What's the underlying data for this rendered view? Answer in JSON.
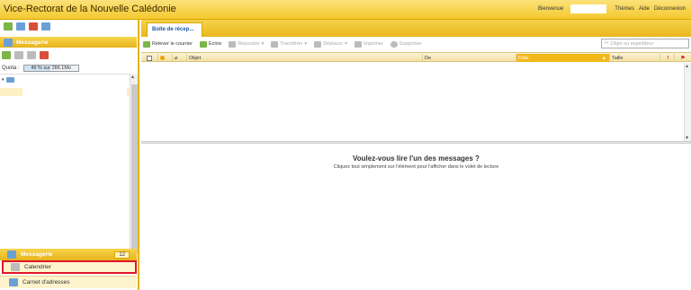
{
  "header": {
    "title": "Vice-Rectorat de la Nouvelle Calédonie",
    "welcome": "Bienvenue",
    "links": [
      "Thèmes",
      "Aide",
      "Déconnexion"
    ]
  },
  "left": {
    "section_title": "Messagerie",
    "quota_label": "Quota :",
    "quota_value": "49 % sur 286.1Mo",
    "quota_percent": 49,
    "nav": {
      "messagerie_label": "Messagerie",
      "messagerie_count": "12",
      "calendrier_label": "Calendrier",
      "carnet_label": "Carnet d'adresses"
    }
  },
  "main": {
    "tab_label": "Boîte de récep...",
    "toolbar": {
      "relever": "Relever le courrier",
      "ecrire": "Ecrire",
      "repondre": "Répondre",
      "transferer": "Transférer",
      "deplacer": "Déplacer",
      "imprimer": "Imprimer",
      "supprimer": "Supprimer"
    },
    "search_placeholder": "Objet ou expéditeur",
    "columns": {
      "objet": "Objet",
      "de": "De",
      "date": "Date",
      "taille": "Taille"
    },
    "reading": {
      "title": "Voulez-vous lire l'un des messages ?",
      "subtitle": "Cliquez tout simplement sur l'élément pour l'afficher dans le volet de lecture"
    }
  }
}
